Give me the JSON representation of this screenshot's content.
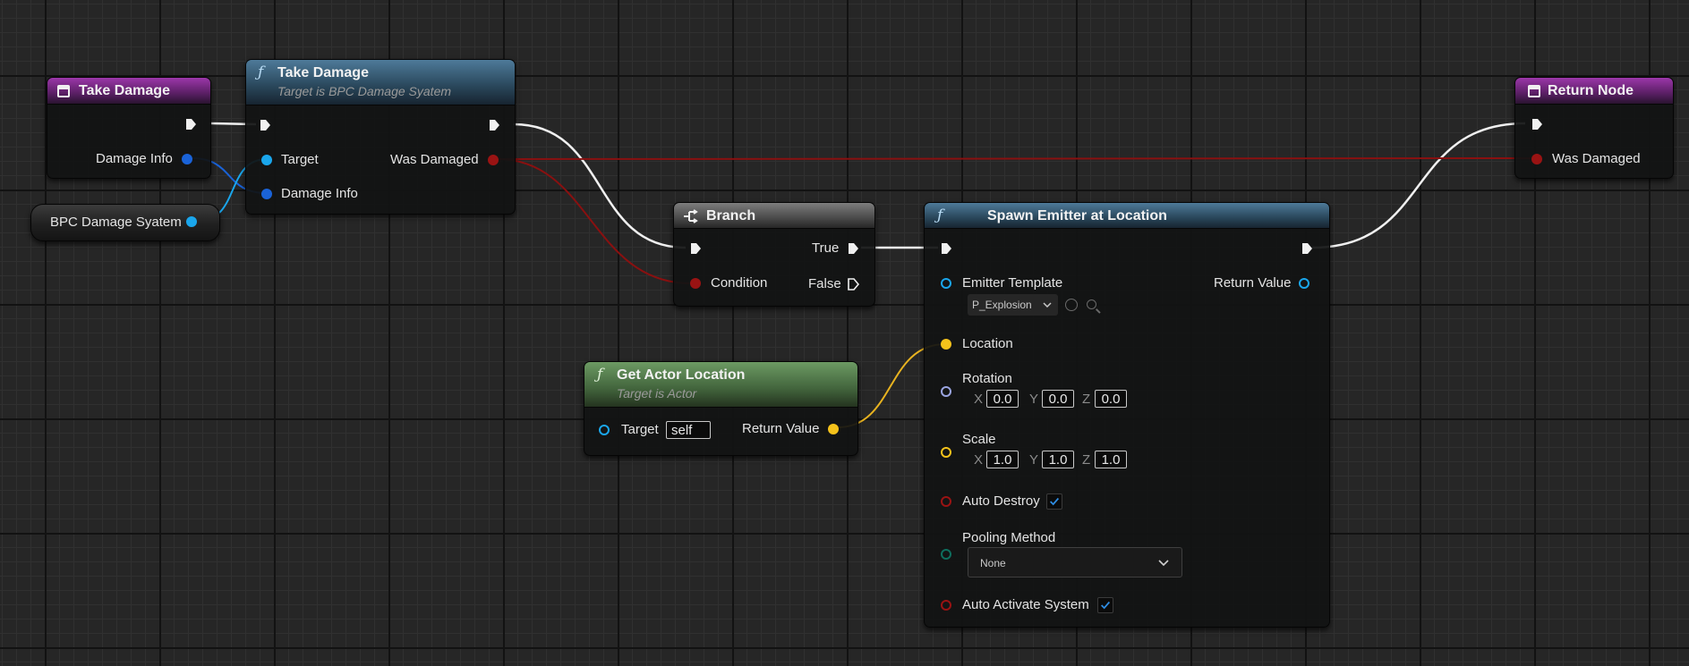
{
  "colors": {
    "exec": "#f0f0f0",
    "struct": "#1a63d8",
    "object": "#1aa6ec",
    "bool": "#9a1313",
    "vector": "#f5c21b",
    "rotator": "#9aa4e0",
    "enum": "#0e6e5e",
    "event_header": "#8b2f9a",
    "function_header": "#3a6986",
    "pure_header": "#5a8a50",
    "branch_header": "#6a6a6a"
  },
  "nodes": {
    "take_damage_event": {
      "title": "Take Damage",
      "icon": "event-icon",
      "damage_info_label": "Damage Info"
    },
    "bpc_variable": {
      "label": "BPC Damage Syatem"
    },
    "take_damage_call": {
      "title": "Take Damage",
      "subtitle": "Target is BPC Damage Syatem",
      "icon": "function-icon",
      "target_label": "Target",
      "damage_info_label": "Damage Info",
      "was_damaged_label": "Was Damaged"
    },
    "branch": {
      "title": "Branch",
      "icon": "branch-icon",
      "condition_label": "Condition",
      "true_label": "True",
      "false_label": "False"
    },
    "get_actor_location": {
      "title": "Get Actor Location",
      "subtitle": "Target is Actor",
      "icon": "function-icon",
      "target_label": "Target",
      "target_value": "self",
      "return_label": "Return Value"
    },
    "spawn_emitter": {
      "title": "Spawn Emitter at Location",
      "icon": "function-icon",
      "emitter_label": "Emitter Template",
      "emitter_value": "P_Explosion",
      "return_label": "Return Value",
      "location_label": "Location",
      "rotation_label": "Rotation",
      "rotation": {
        "x": "0.0",
        "y": "0.0",
        "z": "0.0"
      },
      "scale_label": "Scale",
      "scale": {
        "x": "1.0",
        "y": "1.0",
        "z": "1.0"
      },
      "axis_x": "X",
      "axis_y": "Y",
      "axis_z": "Z",
      "auto_destroy_label": "Auto Destroy",
      "auto_destroy": true,
      "pooling_label": "Pooling Method",
      "pooling_value": "None",
      "auto_activate_label": "Auto Activate System",
      "auto_activate": true
    },
    "return_node": {
      "title": "Return Node",
      "icon": "event-icon",
      "was_damaged_label": "Was Damaged"
    }
  }
}
